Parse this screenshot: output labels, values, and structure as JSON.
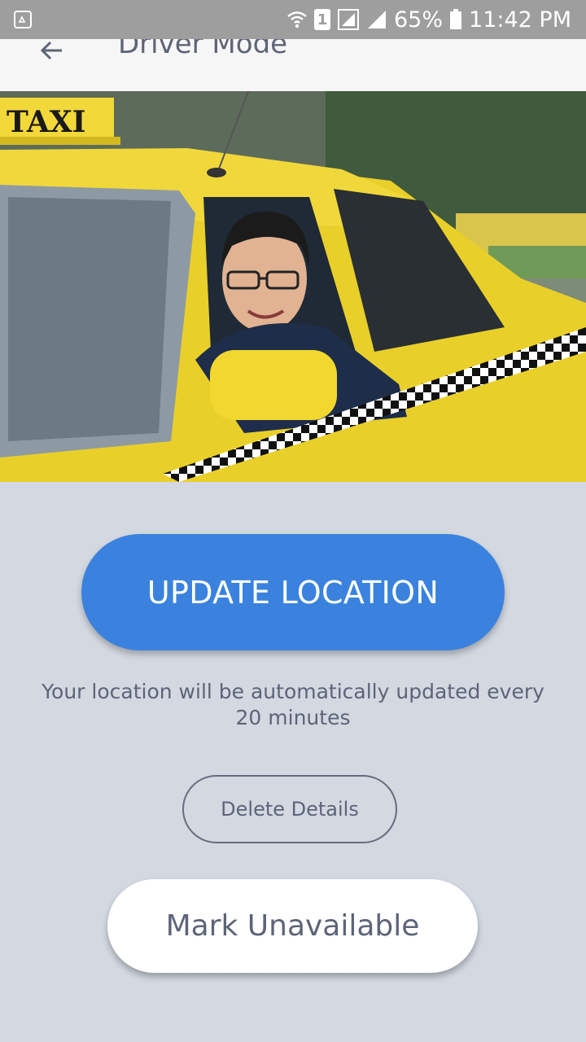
{
  "status_bar": {
    "sim_slot": "1",
    "battery": "65%",
    "time": "11:42 PM",
    "icons": [
      "recycle-icon",
      "wifi-icon",
      "signal-icon",
      "battery-icon"
    ]
  },
  "app_bar": {
    "title": "Driver Mode",
    "back_icon": "arrow-left-icon"
  },
  "hero": {
    "taxi_sign": "TAXI"
  },
  "actions": {
    "update_location": "UPDATE LOCATION",
    "update_hint": "Your location will be automatically updated every 20 minutes",
    "delete_details": "Delete Details",
    "mark_unavailable": "Mark Unavailable"
  },
  "colors": {
    "primary": "#3a82de",
    "background": "#d3d8e1",
    "text": "#5d6478"
  }
}
